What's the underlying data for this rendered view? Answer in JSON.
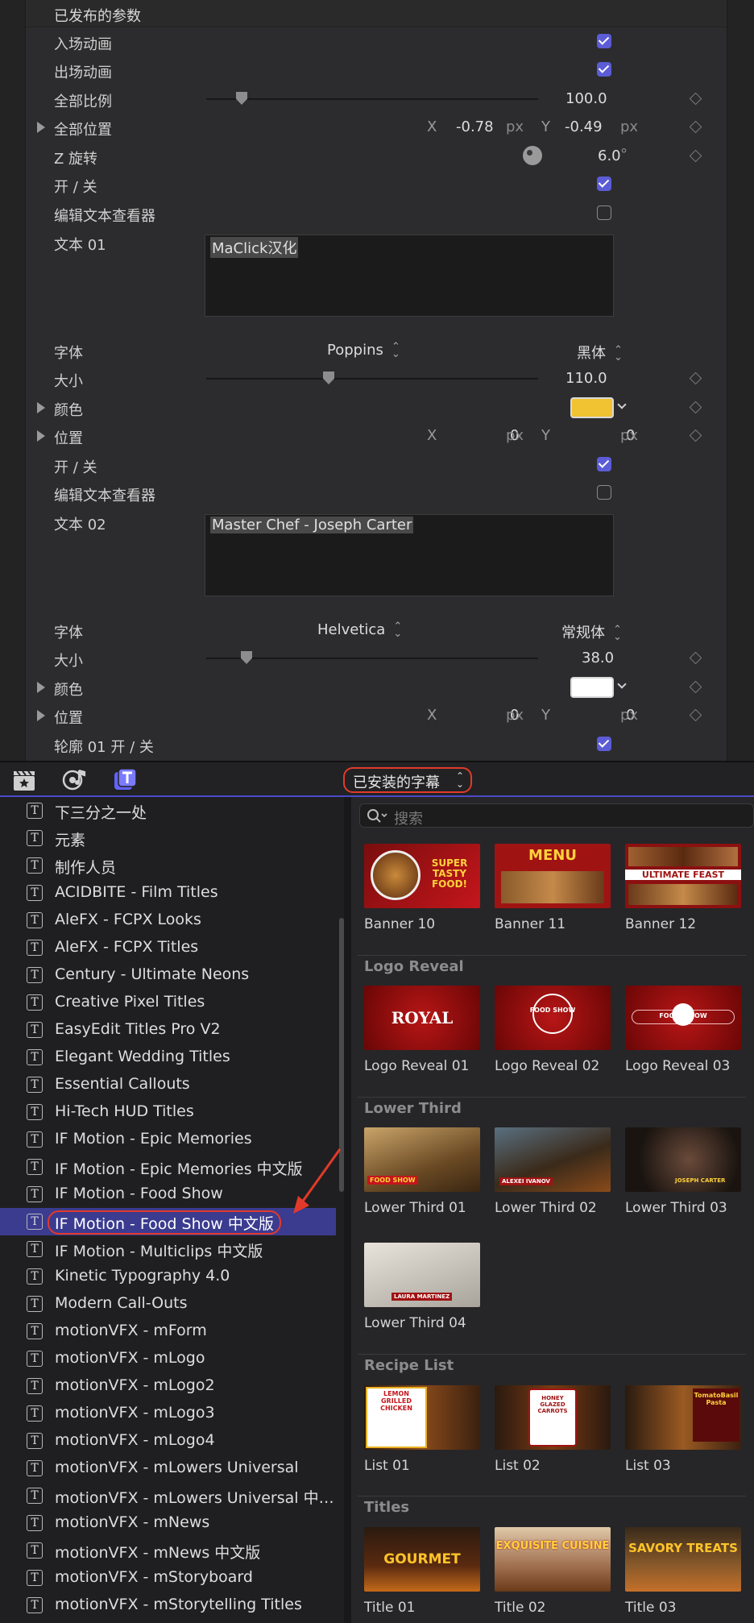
{
  "inspector": {
    "section_title": "已发布的参数",
    "rows": {
      "intro_anim": "入场动画",
      "outro_anim": "出场动画",
      "overall_scale": "全部比例",
      "overall_scale_value": "100.0",
      "overall_pos": "全部位置",
      "overall_pos_x": "-0.78",
      "overall_pos_y": "-0.49",
      "z_rotation": "Z 旋转",
      "z_rotation_value": "6.0",
      "z_rotation_unit": "°",
      "on_off_1": "开 / 关",
      "edit_text_viewer_1": "编辑文本查看器",
      "text01": "文本 01",
      "text01_value": "MaClick汉化",
      "font_1": "字体",
      "font_1_family": "Poppins",
      "font_1_style": "黑体",
      "size_1": "大小",
      "size_1_value": "110.0",
      "color_1": "颜色",
      "color_1_hex": "#f1c232",
      "pos_1": "位置",
      "pos_1_x": "0",
      "pos_1_y": "0",
      "on_off_2": "开 / 关",
      "edit_text_viewer_2": "编辑文本查看器",
      "text02": "文本 02",
      "text02_value": "Master Chef - Joseph Carter",
      "font_2": "字体",
      "font_2_family": "Helvetica",
      "font_2_style": "常规体",
      "size_2": "大小",
      "size_2_value": "38.0",
      "color_2": "颜色",
      "color_2_hex": "#ffffff",
      "pos_2": "位置",
      "pos_2_x": "0",
      "pos_2_y": "0",
      "outline01": "轮廓 01 开 / 关"
    },
    "axis_x": "X",
    "axis_y": "Y",
    "unit_px": "px"
  },
  "toolbar": {
    "selector_label": "已安装的字幕",
    "icons": [
      "clapper-star-icon",
      "music-camera-icon",
      "titles-icon"
    ]
  },
  "sidebar": {
    "items": [
      "下三分之一处",
      "元素",
      "制作人员",
      "ACIDBITE - Film Titles",
      "AleFX - FCPX Looks",
      "AleFX - FCPX Titles",
      "Century - Ultimate Neons",
      "Creative Pixel Titles",
      "EasyEdit Titles Pro V2",
      "Elegant Wedding Titles",
      "Essential Callouts",
      "Hi-Tech HUD Titles",
      "IF Motion - Epic Memories",
      "IF Motion - Epic Memories 中文版",
      "IF Motion - Food Show",
      "IF Motion - Food Show 中文版",
      "IF Motion - Multiclips 中文版",
      "Kinetic Typography 4.0",
      "Modern Call-Outs",
      "motionVFX - mForm",
      "motionVFX - mLogo",
      "motionVFX - mLogo2",
      "motionVFX - mLogo3",
      "motionVFX - mLogo4",
      "motionVFX - mLowers Universal",
      "motionVFX - mLowers Universal 中…",
      "motionVFX - mNews",
      "motionVFX - mNews 中文版",
      "motionVFX - mStoryboard",
      "motionVFX - mStorytelling Titles"
    ],
    "selected_index": 15,
    "icon_glyph": "T"
  },
  "content": {
    "search_placeholder": "搜索",
    "sections": {
      "logo_reveal": "Logo Reveal",
      "lower_third": "Lower Third",
      "recipe_list": "Recipe List",
      "titles": "Titles"
    },
    "banners": [
      "Banner 10",
      "Banner 11",
      "Banner 12"
    ],
    "banner_art": [
      "SUPER TASTY FOOD!",
      "MENU",
      "ULTIMATE FEAST"
    ],
    "logo_reveals": [
      "Logo Reveal 01",
      "Logo Reveal 02",
      "Logo Reveal 03"
    ],
    "logo_art": [
      "ROYAL",
      "FOOD SHOW",
      "FOOD  SHOW"
    ],
    "lower_thirds": [
      "Lower Third 01",
      "Lower Third 02",
      "Lower Third 03",
      "Lower Third 04"
    ],
    "lower_art": [
      "FOOD SHOW",
      "ALEXEI IVANOV",
      "JOSEPH CARTER",
      "LAURA MARTINEZ"
    ],
    "lists": [
      "List 01",
      "List 02",
      "List 03"
    ],
    "list_art": [
      "LEMON GRILLED CHICKEN",
      "HONEY GLAZED CARROTS",
      "TomatoBasil Pasta"
    ],
    "titles": [
      "Title 01",
      "Title 02",
      "Title 03"
    ],
    "title_art": [
      "GOURMET",
      "EXQUISITE CUISINE",
      "SAVORY TREATS"
    ]
  }
}
